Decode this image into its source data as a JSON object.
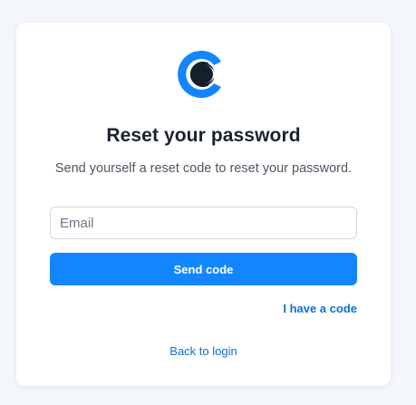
{
  "brand": {
    "logo_icon": "brand-logo-icon",
    "logo_dark": "#15202e",
    "logo_blue": "#1385ff"
  },
  "reset": {
    "title": "Reset your password",
    "subtitle": "Send yourself a reset code to reset your password.",
    "email_placeholder": "Email",
    "email_value": "",
    "send_button_label": "Send code",
    "have_code_link": "I have a code",
    "back_link": "Back to login"
  },
  "colors": {
    "accent": "#1385ff",
    "link": "#0e6fd6",
    "page_bg": "#f3f6fa",
    "card_bg": "#ffffff"
  }
}
